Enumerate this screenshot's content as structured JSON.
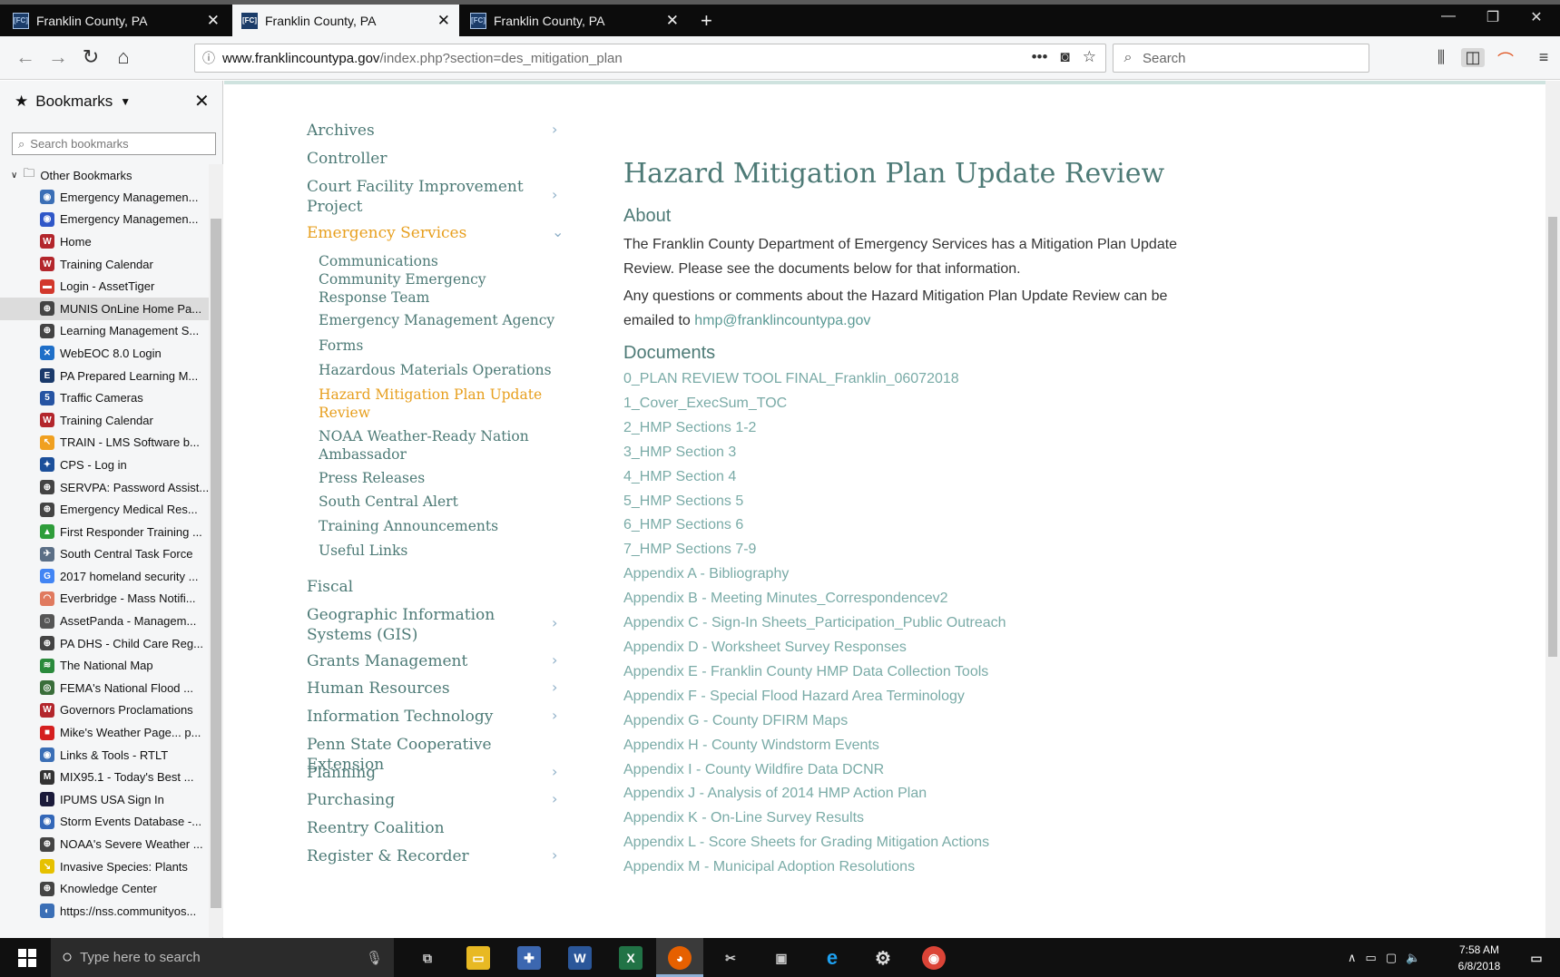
{
  "browser": {
    "tabs": [
      {
        "favicon": "[FC]",
        "title": "Franklin County, PA"
      },
      {
        "favicon": "[FC]",
        "title": "Franklin County, PA"
      },
      {
        "favicon": "[FC]",
        "title": "Franklin County, PA"
      }
    ],
    "new_tab": "+",
    "url_host": "www.franklincountypa.gov",
    "url_path": "/index.php?section=des_mitigation_plan",
    "page_actions_more": "•••",
    "search_placeholder": "Search"
  },
  "sidebar": {
    "title": "Bookmarks",
    "search_placeholder": "Search bookmarks",
    "folder": "Other Bookmarks",
    "items": [
      {
        "label": "Emergency Managemen...",
        "color": "#3b6fb6",
        "glyph": "◉"
      },
      {
        "label": "Emergency Managemen...",
        "color": "#2f57c8",
        "glyph": "◉"
      },
      {
        "label": "Home",
        "color": "#b3262c",
        "glyph": "W"
      },
      {
        "label": "Training Calendar",
        "color": "#b3262c",
        "glyph": "W"
      },
      {
        "label": "Login - AssetTiger",
        "color": "#d2382c",
        "glyph": "▬"
      },
      {
        "label": "MUNIS OnLine Home Pa...",
        "color": "#444",
        "glyph": "⊕"
      },
      {
        "label": "Learning Management S...",
        "color": "#444",
        "glyph": "⊕"
      },
      {
        "label": "WebEOC 8.0 Login",
        "color": "#1f6fc8",
        "glyph": "✕"
      },
      {
        "label": "PA Prepared Learning M...",
        "color": "#1a3a6b",
        "glyph": "E"
      },
      {
        "label": "Traffic Cameras",
        "color": "#2654a3",
        "glyph": "5"
      },
      {
        "label": "Training Calendar",
        "color": "#b3262c",
        "glyph": "W"
      },
      {
        "label": "TRAIN - LMS Software b...",
        "color": "#f0a020",
        "glyph": "↖"
      },
      {
        "label": "CPS - Log in",
        "color": "#1b4f9a",
        "glyph": "✦"
      },
      {
        "label": "SERVPA: Password Assist...",
        "color": "#444",
        "glyph": "⊕"
      },
      {
        "label": "Emergency Medical Res...",
        "color": "#444",
        "glyph": "⊕"
      },
      {
        "label": "First Responder Training ...",
        "color": "#2e9d3a",
        "glyph": "▲"
      },
      {
        "label": "South Central Task Force",
        "color": "#5b6f86",
        "glyph": "✈"
      },
      {
        "label": "2017 homeland security ...",
        "color": "#4285f4",
        "glyph": "G"
      },
      {
        "label": "Everbridge - Mass Notifi...",
        "color": "#e07a5f",
        "glyph": "◠"
      },
      {
        "label": "AssetPanda - Managem...",
        "color": "#555",
        "glyph": "☺"
      },
      {
        "label": "PA DHS - Child Care Reg...",
        "color": "#444",
        "glyph": "⊕"
      },
      {
        "label": "The National Map",
        "color": "#2a8a3c",
        "glyph": "≋"
      },
      {
        "label": "FEMA's National Flood ...",
        "color": "#3a6e3a",
        "glyph": "◎"
      },
      {
        "label": "Governors Proclamations",
        "color": "#b3262c",
        "glyph": "W"
      },
      {
        "label": "Mike's Weather Page... p...",
        "color": "#d51f1f",
        "glyph": "■"
      },
      {
        "label": "Links & Tools - RTLT",
        "color": "#3b6fb6",
        "glyph": "◉"
      },
      {
        "label": "MIX95.1 - Today's Best ...",
        "color": "#333",
        "glyph": "M"
      },
      {
        "label": "IPUMS USA Sign In",
        "color": "#1a1a3a",
        "glyph": "I"
      },
      {
        "label": "Storm Events Database -...",
        "color": "#3367b8",
        "glyph": "◉"
      },
      {
        "label": "NOAA's Severe Weather ...",
        "color": "#444",
        "glyph": "⊕"
      },
      {
        "label": "Invasive Species: Plants",
        "color": "#e6c100",
        "glyph": "↘"
      },
      {
        "label": "Knowledge Center",
        "color": "#444",
        "glyph": "⊕"
      },
      {
        "label": "https://nss.communityos...",
        "color": "#3b6fb6",
        "glyph": "◐"
      }
    ]
  },
  "leftnav": {
    "items": [
      {
        "label": "Archives",
        "chevron": true,
        "active": false
      },
      {
        "label": "Controller",
        "chevron": false,
        "active": false
      },
      {
        "label": "Court Facility Improvement Project",
        "chevron": true,
        "active": false
      },
      {
        "label": "Emergency Services",
        "chevron": true,
        "active": true,
        "expanded": true
      },
      {
        "label": "Fiscal",
        "chevron": false,
        "active": false
      },
      {
        "label": "Geographic Information Systems (GIS)",
        "chevron": true,
        "active": false
      },
      {
        "label": "Grants Management",
        "chevron": true,
        "active": false
      },
      {
        "label": "Human Resources",
        "chevron": true,
        "active": false
      },
      {
        "label": "Information Technology",
        "chevron": true,
        "active": false
      },
      {
        "label": "Penn State Cooperative Extension",
        "chevron": false,
        "active": false
      },
      {
        "label": "Planning",
        "chevron": true,
        "active": false
      },
      {
        "label": "Purchasing",
        "chevron": true,
        "active": false
      },
      {
        "label": "Reentry Coalition",
        "chevron": false,
        "active": false
      },
      {
        "label": "Register & Recorder",
        "chevron": true,
        "active": false
      }
    ],
    "subitems": [
      {
        "label": "Communications",
        "active": false
      },
      {
        "label": "Community Emergency Response Team",
        "active": false
      },
      {
        "label": "Emergency Management Agency",
        "active": false
      },
      {
        "label": "Forms",
        "active": false
      },
      {
        "label": "Hazardous Materials Operations",
        "active": false
      },
      {
        "label": "Hazard Mitigation Plan Update Review",
        "active": true
      },
      {
        "label": "NOAA Weather-Ready Nation Ambassador",
        "active": false
      },
      {
        "label": "Press Releases",
        "active": false
      },
      {
        "label": "South Central Alert",
        "active": false
      },
      {
        "label": "Training Announcements",
        "active": false
      },
      {
        "label": "Useful Links",
        "active": false
      }
    ]
  },
  "content": {
    "title": "Hazard Mitigation Plan Update Review",
    "about_heading": "About",
    "about_p1": "The Franklin County Department of Emergency Services has a Mitigation Plan Update Review. Please see the documents below for that information.",
    "about_p2_prefix": "Any questions or comments about the Hazard Mitigation Plan Update Review can be emailed to ",
    "email": "hmp@franklincountypa.gov",
    "documents_heading": "Documents",
    "documents": [
      "0_PLAN REVIEW TOOL FINAL_Franklin_06072018",
      "1_Cover_ExecSum_TOC",
      "2_HMP Sections 1-2",
      "3_HMP Section 3",
      "4_HMP Section 4",
      "5_HMP Sections 5",
      "6_HMP Sections 6",
      "7_HMP Sections 7-9",
      "Appendix A - Bibliography",
      "Appendix B - Meeting Minutes_Correspondencev2",
      "Appendix C - Sign-In Sheets_Participation_Public Outreach",
      "Appendix D - Worksheet Survey Responses",
      "Appendix E - Franklin County HMP Data Collection Tools",
      "Appendix F - Special Flood Hazard Area Terminology",
      "Appendix G - County DFIRM Maps",
      "Appendix H - County Windstorm Events",
      "Appendix I - County Wildfire Data DCNR",
      "Appendix J - Analysis of 2014 HMP Action Plan",
      "Appendix K - On-Line Survey Results",
      "Appendix L - Score Sheets for Grading Mitigation Actions",
      "Appendix M - Municipal Adoption Resolutions"
    ]
  },
  "taskbar": {
    "search_placeholder": "Type here to search",
    "time": "7:58 AM",
    "date": "6/8/2018"
  }
}
